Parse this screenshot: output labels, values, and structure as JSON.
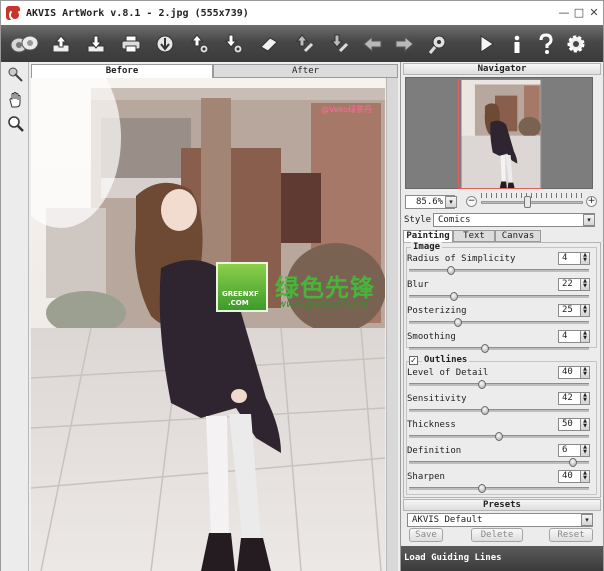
{
  "window": {
    "title": "AKVIS ArtWork v.8.1 - 2.jpg (555x739)",
    "min": "—",
    "max": "□",
    "close": "✕"
  },
  "toolbar": {
    "icons": [
      "effects-icon",
      "open-icon",
      "save-icon",
      "print-icon",
      "share-icon",
      "upload-settings-icon",
      "download-settings-icon",
      "eraser-icon",
      "load-strokes-icon",
      "save-strokes-icon",
      "undo-icon",
      "redo-icon",
      "preferences-icon",
      "run-icon",
      "info-icon",
      "help-icon",
      "settings-icon"
    ]
  },
  "left_tools": [
    "magic-brush-icon",
    "hand-icon",
    "zoom-icon"
  ],
  "tabs": {
    "before": "Before",
    "after": "After"
  },
  "watermark": {
    "site_big": "绿色先锋",
    "site_url": "www.greenxf.com",
    "logo_line1": "GREENXF",
    "logo_line2": ".COM",
    "corner": "@Veko绿茶丹"
  },
  "navigator": {
    "title": "Navigator",
    "zoom": "85.6%",
    "zoom_level": 0.45,
    "minus": "−",
    "plus": "+"
  },
  "style": {
    "label": "Style:",
    "value": "Comics"
  },
  "param_tabs": [
    "Painting",
    "Text",
    "Canvas"
  ],
  "groups": {
    "image": "Image",
    "outlines": "Outlines"
  },
  "outlines_checked": true,
  "params": [
    {
      "label": "Radius of Simplicity",
      "value": "4",
      "level": 0.22
    },
    {
      "label": "Blur",
      "value": "22",
      "level": 0.24
    },
    {
      "label": "Posterizing",
      "value": "25",
      "level": 0.26
    },
    {
      "label": "Smoothing",
      "value": "4",
      "level": 0.42
    },
    {
      "label": "Level of Detail",
      "value": "40",
      "level": 0.4
    },
    {
      "label": "Sensitivity",
      "value": "42",
      "level": 0.42
    },
    {
      "label": "Thickness",
      "value": "50",
      "level": 0.5
    },
    {
      "label": "Definition",
      "value": "6",
      "level": 0.93
    },
    {
      "label": "Sharpen",
      "value": "40",
      "level": 0.4
    }
  ],
  "presets": {
    "title": "Presets",
    "value": "AKVIS Default",
    "save": "Save",
    "delete": "Delete",
    "reset": "Reset"
  },
  "status": {
    "text": "Load Guiding Lines"
  }
}
